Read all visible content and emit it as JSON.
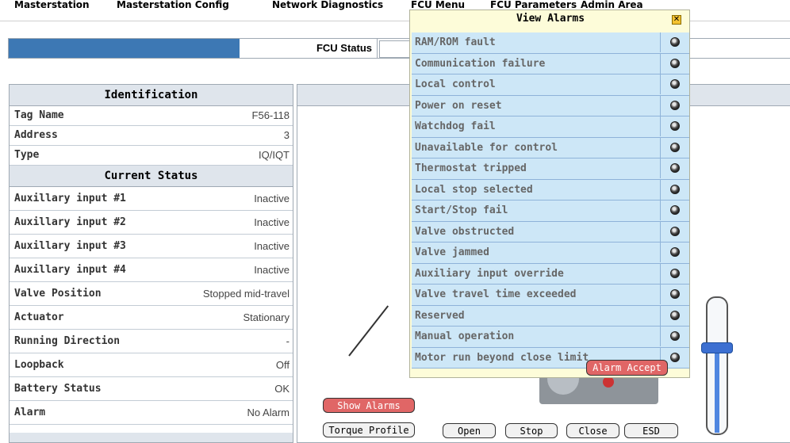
{
  "menu": [
    "Masterstation",
    "Masterstation Config",
    "Network Diagnostics",
    "FCU Menu",
    "FCU Parameters",
    "Admin Area"
  ],
  "status": {
    "label": "FCU Status"
  },
  "identification": {
    "title": "Identification",
    "rows": [
      {
        "key": "Tag Name",
        "value": "F56-118"
      },
      {
        "key": "Address",
        "value": "3"
      },
      {
        "key": "Type",
        "value": "IQ/IQT"
      }
    ]
  },
  "current_status": {
    "title": "Current Status",
    "rows": [
      {
        "key": "Auxillary input #1",
        "value": "Inactive"
      },
      {
        "key": "Auxillary input #2",
        "value": "Inactive"
      },
      {
        "key": "Auxillary input #3",
        "value": "Inactive"
      },
      {
        "key": "Auxillary input #4",
        "value": "Inactive"
      },
      {
        "key": "Valve Position",
        "value": "Stopped mid-travel"
      },
      {
        "key": "Actuator",
        "value": "Stationary"
      },
      {
        "key": "Running Direction",
        "value": "-"
      },
      {
        "key": "Loopback",
        "value": "Off"
      },
      {
        "key": "Battery Status",
        "value": "OK"
      },
      {
        "key": "Alarm",
        "value": "No Alarm"
      }
    ]
  },
  "alarms": {
    "title": "View Alarms",
    "items": [
      "RAM/ROM fault",
      "Communication failure",
      "Local control",
      "Power on reset",
      "Watchdog fail",
      "Unavailable for control",
      "Thermostat tripped",
      "Local stop selected",
      "Start/Stop fail",
      "Valve obstructed",
      "Valve jammed",
      "Auxiliary input override",
      "Valve travel time exceeded",
      "Reserved",
      "Manual operation",
      "Motor run beyond close limit"
    ],
    "accept_label": "Alarm Accept",
    "indicator_icon": "alarm-led-icon",
    "close_icon": "close-icon"
  },
  "buttons": {
    "show_alarms": "Show Alarms",
    "torque_profile": "Torque Profile",
    "open": "Open",
    "stop": "Stop",
    "close": "Close",
    "esd": "ESD"
  },
  "slider": {
    "value_fraction": 0.4
  },
  "colors": {
    "accent_blue": "#3d78b4",
    "alarm_popup_bg": "#fdfcd9",
    "alarm_row_bg": "#cde7f7",
    "alarm_button": "#e06666"
  }
}
